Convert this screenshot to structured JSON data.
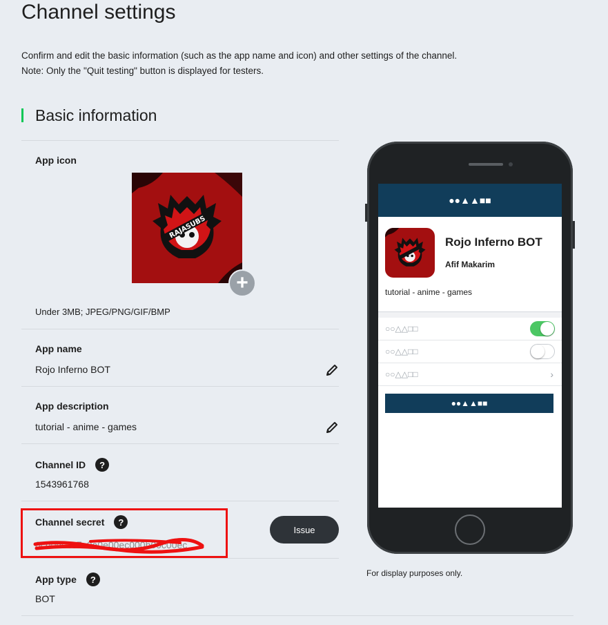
{
  "page": {
    "title": "Channel settings",
    "intro_line1": "Confirm and edit the basic information (such as the app name and icon) and other settings of the channel.",
    "intro_line2": "Note: Only the \"Quit testing\" button is displayed for testers."
  },
  "section": {
    "title": "Basic information",
    "accent_color": "#06c755"
  },
  "app_icon": {
    "label": "App icon",
    "hint": "Under 3MB; JPEG/PNG/GIF/BMP",
    "add_symbol": "+"
  },
  "app_name": {
    "label": "App name",
    "value": "Rojo Inferno BOT"
  },
  "app_description": {
    "label": "App description",
    "value": "tutorial - anime - games"
  },
  "channel_id": {
    "label": "Channel ID",
    "value": "1543961768",
    "help": "?"
  },
  "channel_secret": {
    "label": "Channel secret",
    "help": "?",
    "issue_label": "Issue",
    "value_redacted": true,
    "highlight_color": "#ee1111"
  },
  "app_type": {
    "label": "App type",
    "value": "BOT",
    "help": "?"
  },
  "preview": {
    "header_placeholder": "●●▲▲■■",
    "app_name": "Rojo Inferno BOT",
    "author": "Afif Makarim",
    "description": "tutorial - anime - games",
    "rows": [
      {
        "label": "○○△△□□",
        "control": "toggle-on"
      },
      {
        "label": "○○△△□□",
        "control": "toggle-off"
      },
      {
        "label": "○○△△□□",
        "control": "chevron"
      }
    ],
    "chevron": "›",
    "action_placeholder": "●●▲▲■■",
    "note": "For display purposes only.",
    "header_color": "#113d5a",
    "toggle_on_color": "#4cc764"
  },
  "icons": {
    "edit": "pencil-icon",
    "help": "question-circle-icon",
    "add": "plus-icon"
  }
}
